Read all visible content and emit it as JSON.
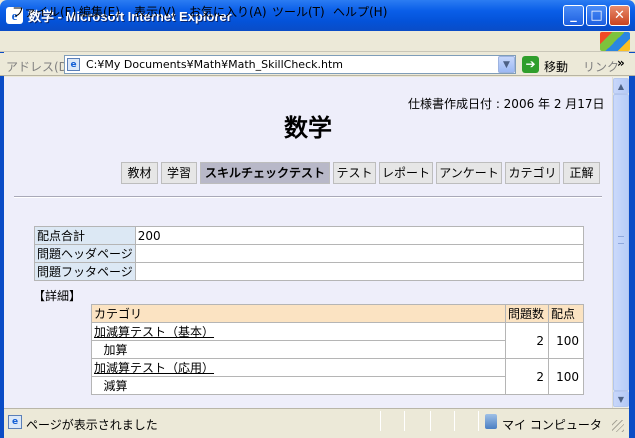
{
  "window": {
    "title": "数学 - Microsoft Internet Explorer",
    "app_icon_glyph": "e"
  },
  "menu": [
    "ファイル(F)",
    "編集(E)",
    "表示(V)",
    "お気に入り(A)",
    "ツール(T)",
    "ヘルプ(H)"
  ],
  "address": {
    "label": "アドレス(D)",
    "value": "C:¥My Documents¥Math¥Math_SkillCheck.htm",
    "go_label": "移動",
    "links_label": "リンク",
    "more_glyph": "»"
  },
  "page": {
    "spec_date": "仕様書作成日付 : 2006 年 2 月17日",
    "title": "数学",
    "tabs": [
      "教材",
      "学習",
      "スキルチェックテスト",
      "テスト",
      "レポート",
      "アンケート",
      "カテゴリ",
      "正解"
    ],
    "active_tab": "スキルチェックテスト",
    "summary": [
      {
        "label": "配点合計",
        "value": "200"
      },
      {
        "label": "問題ヘッダページ",
        "value": ""
      },
      {
        "label": "問題フッタページ",
        "value": ""
      }
    ],
    "details_label": "【詳細】",
    "detail_headers": {
      "category": "カテゴリ",
      "count": "問題数",
      "points": "配点"
    },
    "detail_rows": [
      {
        "category": "加減算テスト（基本）",
        "sub": "加算",
        "count": "2",
        "points": "100"
      },
      {
        "category": "加減算テスト（応用）",
        "sub": "減算",
        "count": "2",
        "points": "100"
      }
    ]
  },
  "status": {
    "text": "ページが表示されました",
    "zone": "マイ コンピュータ"
  },
  "icons": {
    "minimize": "minimize-icon",
    "maximize": "maximize-icon",
    "close": "close-icon",
    "go": "go-arrow-icon",
    "scroll_up": "scroll-up-icon",
    "scroll_down": "scroll-down-icon"
  }
}
